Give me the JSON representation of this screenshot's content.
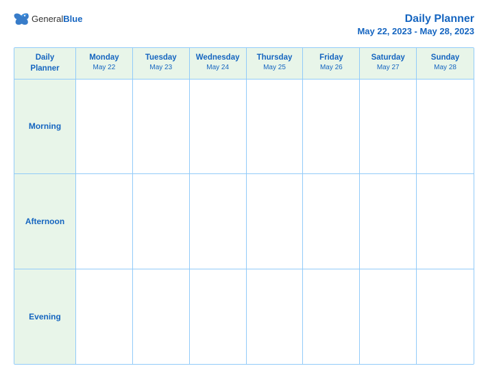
{
  "logo": {
    "general": "General",
    "blue": "Blue"
  },
  "title": {
    "main": "Daily Planner",
    "date_range": "May 22, 2023 - May 28, 2023"
  },
  "header_row": {
    "first_col": "Daily\nPlanner",
    "days": [
      {
        "name": "Monday",
        "date": "May 22"
      },
      {
        "name": "Tuesday",
        "date": "May 23"
      },
      {
        "name": "Wednesday",
        "date": "May 24"
      },
      {
        "name": "Thursday",
        "date": "May 25"
      },
      {
        "name": "Friday",
        "date": "May 26"
      },
      {
        "name": "Saturday",
        "date": "May 27"
      },
      {
        "name": "Sunday",
        "date": "May 28"
      }
    ]
  },
  "rows": [
    {
      "label": "Morning"
    },
    {
      "label": "Afternoon"
    },
    {
      "label": "Evening"
    }
  ]
}
